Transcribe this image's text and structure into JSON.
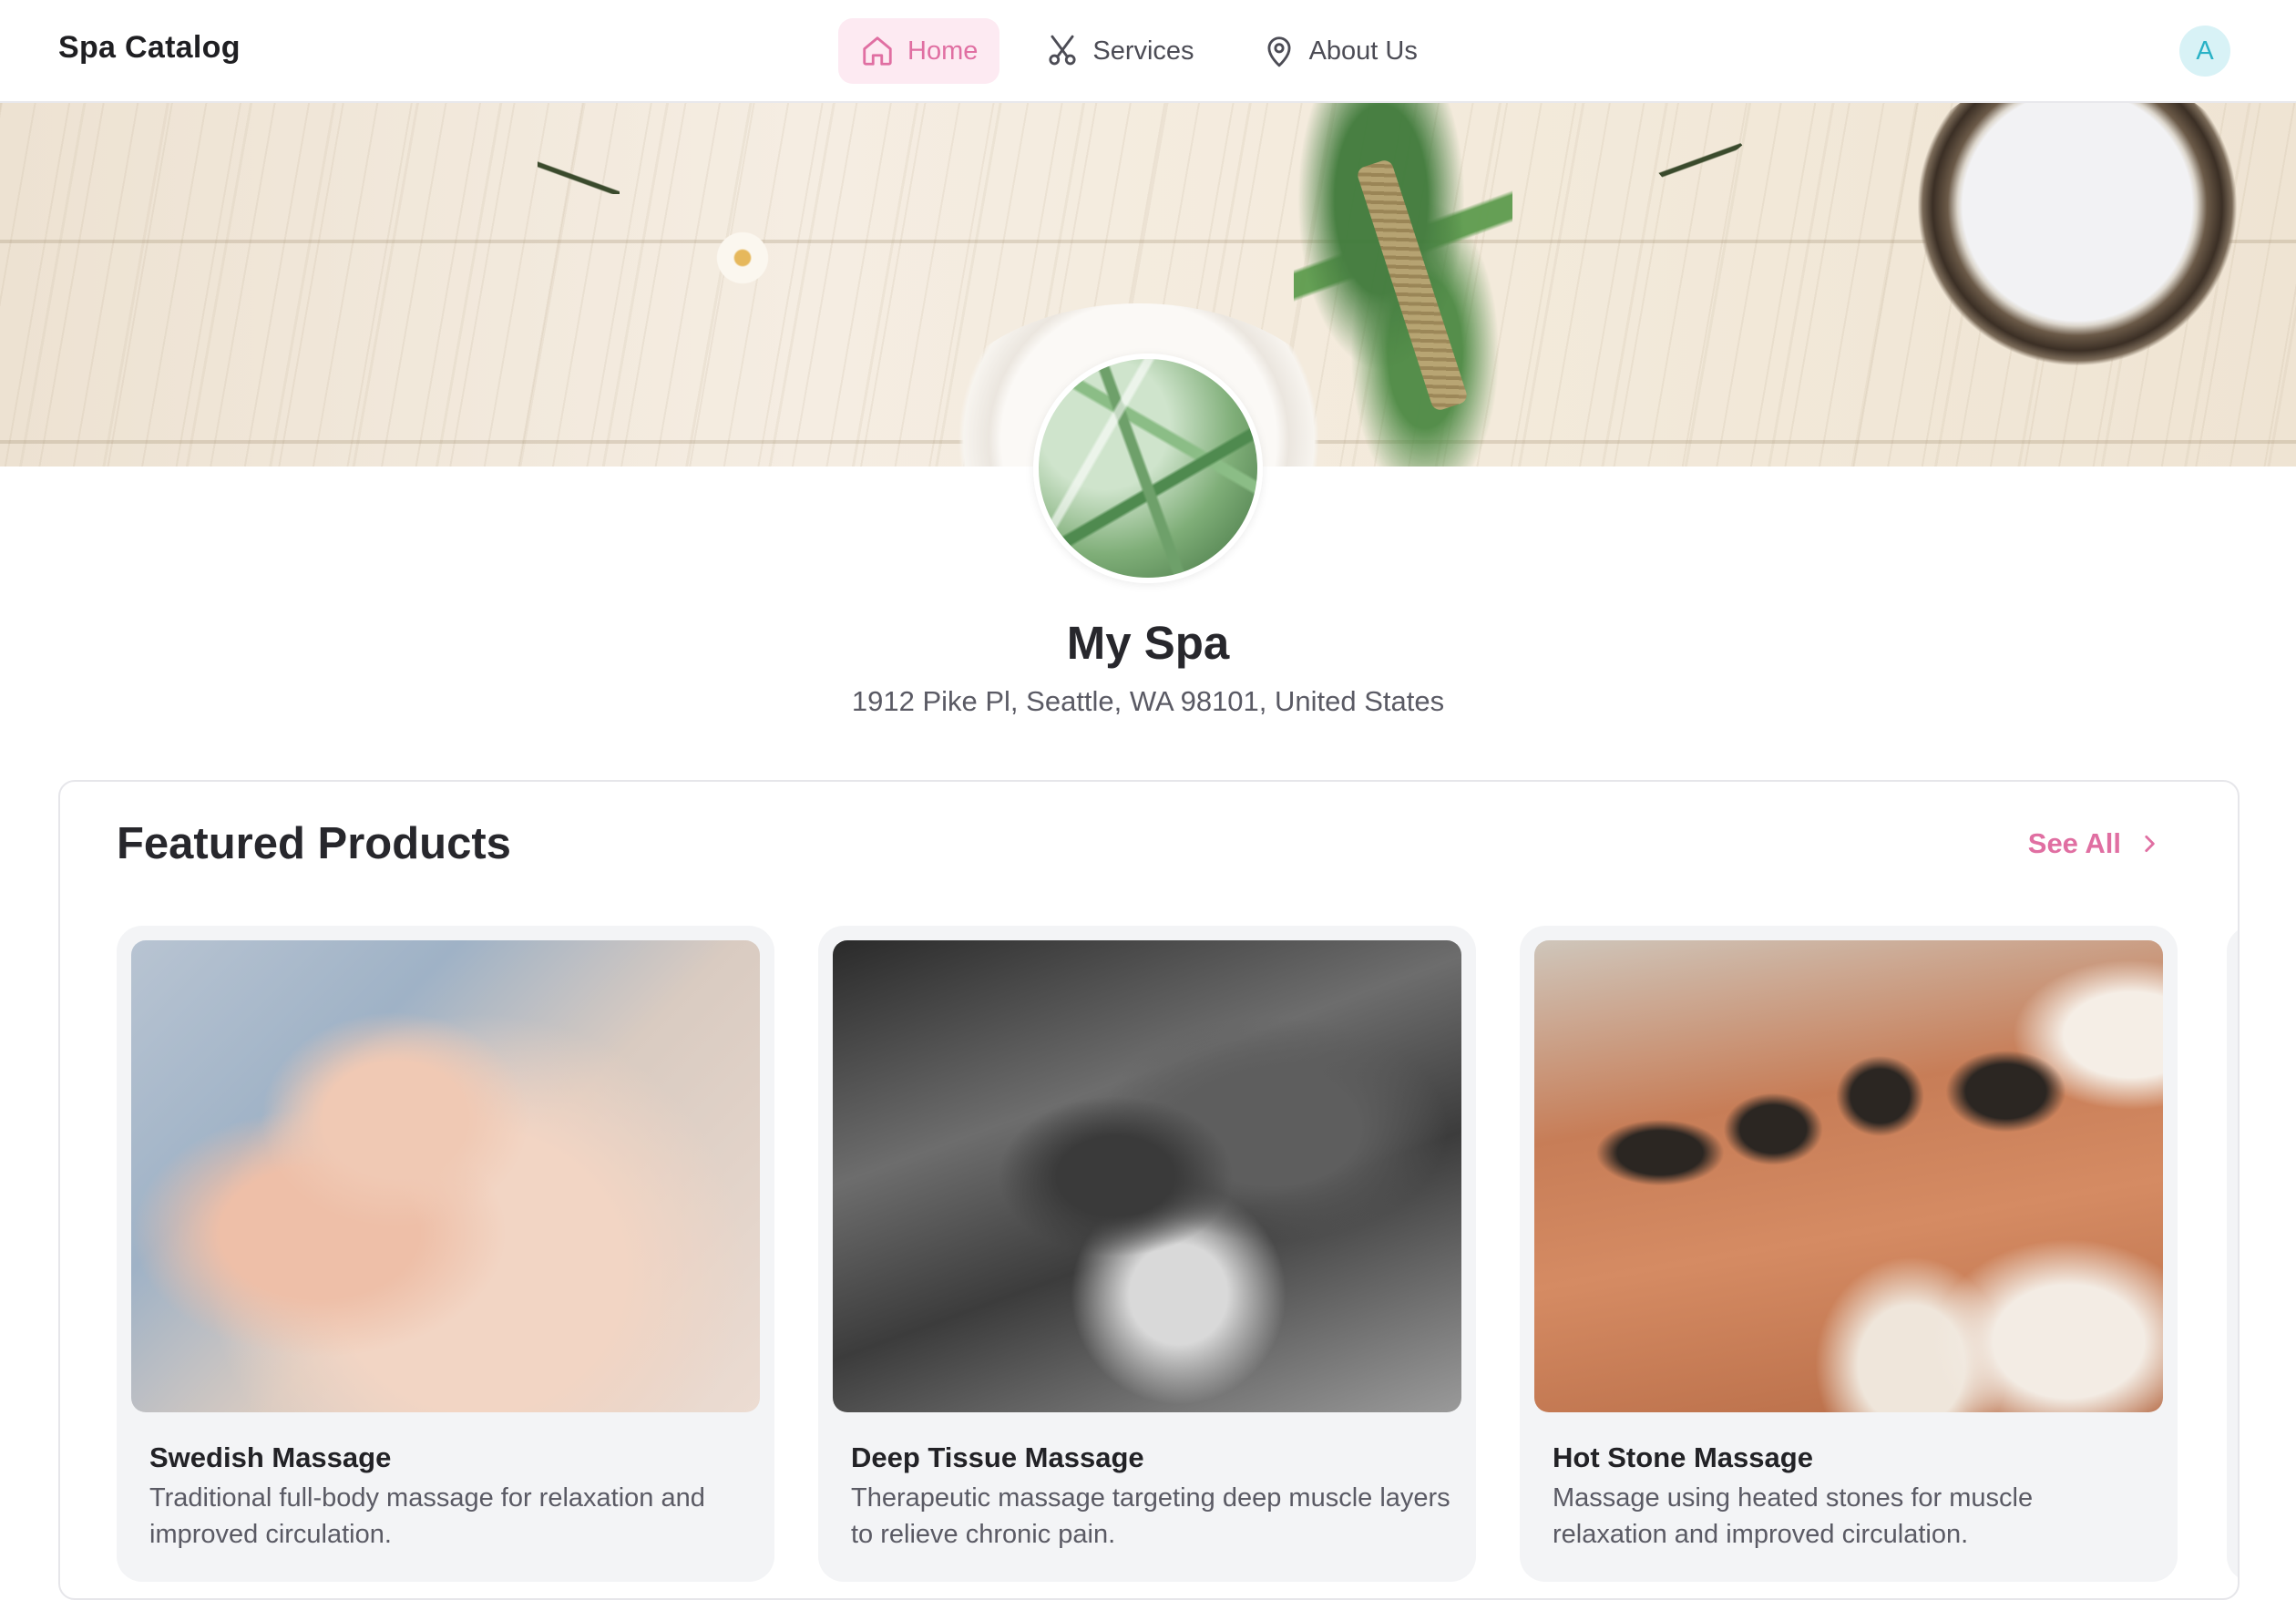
{
  "header": {
    "brand": "Spa Catalog",
    "nav": [
      {
        "label": "Home",
        "icon": "home-icon",
        "active": true
      },
      {
        "label": "Services",
        "icon": "scissors-icon",
        "active": false
      },
      {
        "label": "About Us",
        "icon": "map-pin-icon",
        "active": false
      }
    ],
    "avatar_initial": "A"
  },
  "profile": {
    "name": "My Spa",
    "address": "1912 Pike Pl, Seattle, WA 98101, United States"
  },
  "featured": {
    "title": "Featured Products",
    "see_all_label": "See All",
    "products": [
      {
        "title": "Swedish Massage",
        "description": "Traditional full-body massage for relaxation and improved circulation."
      },
      {
        "title": "Deep Tissue Massage",
        "description": "Therapeutic massage targeting deep muscle layers to relieve chronic pain."
      },
      {
        "title": "Hot Stone Massage",
        "description": "Massage using heated stones for muscle relaxation and improved circulation."
      }
    ]
  },
  "colors": {
    "accent": "#e06fa2",
    "accent_bg": "#fdeaf2",
    "avatar_bg": "#d8f2f6",
    "avatar_fg": "#2ab2c6",
    "card_bg": "#f3f4f6"
  }
}
